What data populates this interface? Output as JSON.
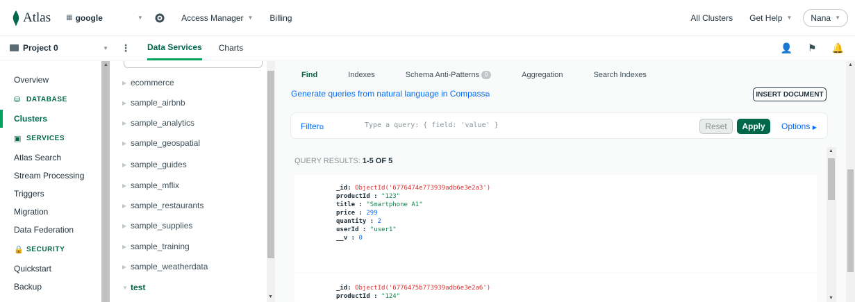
{
  "topbar": {
    "logo_text": "Atlas",
    "org_name": "google",
    "access_manager": "Access Manager",
    "billing": "Billing",
    "all_clusters": "All Clusters",
    "get_help": "Get Help",
    "user": "Nana"
  },
  "subbar": {
    "project": "Project 0",
    "tabs": [
      "Data Services",
      "Charts"
    ]
  },
  "sidebar": {
    "overview": "Overview",
    "database_section": "DATABASE",
    "clusters": "Clusters",
    "services_section": "SERVICES",
    "services": [
      "Atlas Search",
      "Stream Processing",
      "Triggers",
      "Migration",
      "Data Federation"
    ],
    "security_section": "SECURITY",
    "security": [
      "Quickstart",
      "Backup"
    ]
  },
  "databases": [
    "ecommerce",
    "sample_airbnb",
    "sample_analytics",
    "sample_geospatial",
    "sample_guides",
    "sample_mflix",
    "sample_restaurants",
    "sample_supplies",
    "sample_training",
    "sample_weatherdata",
    "test"
  ],
  "main": {
    "tabs": [
      "Find",
      "Indexes",
      "Schema Anti-Patterns",
      "Aggregation",
      "Search Indexes"
    ],
    "schema_badge": "0",
    "nl_link": "Generate queries from natural language in Compass",
    "insert_document": "INSERT DOCUMENT",
    "filter_label": "Filter",
    "filter_placeholder": "Type a query: { field: 'value' }",
    "reset": "Reset",
    "apply": "Apply",
    "options": "Options",
    "results_prefix": "QUERY RESULTS:",
    "results_range": "1-5 OF 5"
  },
  "documents": [
    {
      "_id": "ObjectId('6776474e773939adb6e3e2a3')",
      "productId": "\"123\"",
      "title": "\"Smartphone A1\"",
      "price": "299",
      "quantity": "2",
      "userId": "\"user1\"",
      "__v": "0"
    },
    {
      "_id": "ObjectId('6776475b773939adb6e3e2a6')",
      "productId": "\"124\""
    }
  ],
  "colors": {
    "brand_green": "#00684a",
    "accent_green": "#00a35c",
    "link_blue": "#016bf8"
  }
}
